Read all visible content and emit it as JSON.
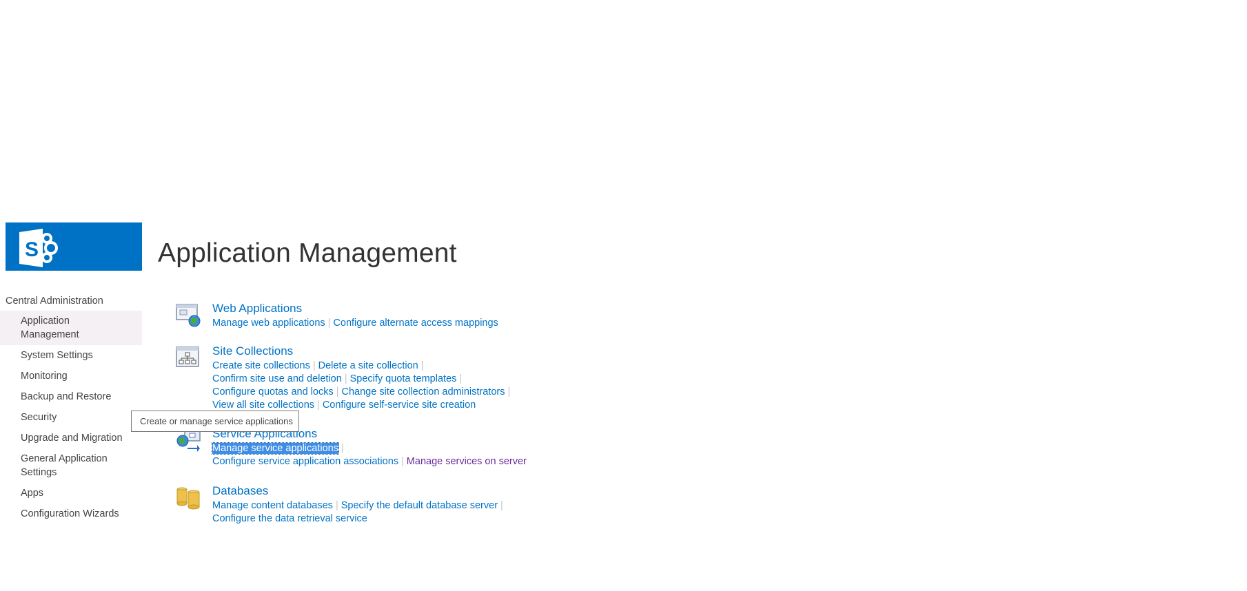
{
  "page": {
    "title": "Application Management"
  },
  "brand": {
    "logo_icon": "sharepoint-logo-icon",
    "logo_color": "#0072c6",
    "link_color": "#0072c6",
    "visited_color": "#6a2b9b",
    "highlight_color": "#3e8ee6"
  },
  "nav": {
    "root": "Central Administration",
    "items": [
      {
        "label": "Application Management",
        "lines": [
          "Application",
          "Management"
        ],
        "selected": true
      },
      {
        "label": "System Settings"
      },
      {
        "label": "Monitoring"
      },
      {
        "label": "Backup and Restore"
      },
      {
        "label": "Security"
      },
      {
        "label": "Upgrade and Migration"
      },
      {
        "label": "General Application Settings",
        "lines": [
          "General Application",
          "Settings"
        ]
      },
      {
        "label": "Apps"
      },
      {
        "label": "Configuration Wizards"
      }
    ]
  },
  "sections": {
    "web_applications": {
      "heading": "Web Applications",
      "icon": "web-applications-icon",
      "rows": [
        [
          "Manage web applications",
          "Configure alternate access mappings"
        ]
      ]
    },
    "site_collections": {
      "heading": "Site Collections",
      "icon": "site-collections-icon",
      "rows": [
        [
          "Create site collections",
          "Delete a site collection"
        ],
        [
          "Confirm site use and deletion",
          "Specify quota templates"
        ],
        [
          "Configure quotas and locks",
          "Change site collection administrators"
        ],
        [
          "View all site collections",
          "Configure self-service site creation"
        ]
      ]
    },
    "service_applications": {
      "heading": "Service Applications",
      "icon": "service-applications-icon",
      "rows": [
        [
          "Manage service applications"
        ],
        [
          "Configure service application associations",
          "Manage services on server"
        ]
      ]
    },
    "databases": {
      "heading": "Databases",
      "icon": "databases-icon",
      "rows": [
        [
          "Manage content databases",
          "Specify the default database server"
        ],
        [
          "Configure the data retrieval service"
        ]
      ]
    }
  },
  "tooltip": {
    "text": "Create or manage service applications"
  }
}
